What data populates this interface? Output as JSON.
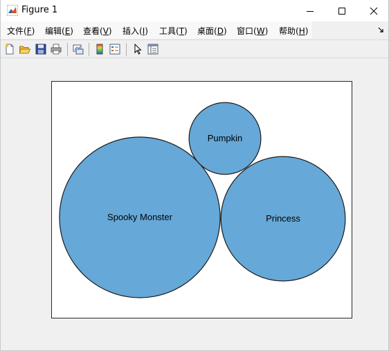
{
  "window": {
    "title": "Figure 1",
    "icons": {
      "app": "matlab-icon",
      "minimize": "minimize-icon",
      "maximize": "maximize-icon",
      "close": "close-icon"
    }
  },
  "menu": {
    "items": [
      {
        "label": "文件(",
        "key": "F",
        "end": ")"
      },
      {
        "label": "编辑(",
        "key": "E",
        "end": ")"
      },
      {
        "label": "查看(",
        "key": "V",
        "end": ")"
      },
      {
        "label": "插入(",
        "key": "I",
        "end": ")"
      },
      {
        "label": "工具(",
        "key": "T",
        "end": ")"
      },
      {
        "label": "桌面(",
        "key": "D",
        "end": ")"
      },
      {
        "label": "窗口(",
        "key": "W",
        "end": ")"
      },
      {
        "label": "帮助(",
        "key": "H",
        "end": ")"
      }
    ],
    "overflow_icon": "expand-arrow-icon"
  },
  "toolbar": {
    "buttons": [
      "new-figure-icon",
      "open-file-icon",
      "save-icon",
      "print-icon",
      "link-plot-icon",
      "colorbar-icon",
      "legend-icon",
      "pointer-icon",
      "property-inspector-icon"
    ]
  },
  "colors": {
    "bubble_fill": "#66a8d7",
    "bubble_edge": "#1a1a1a",
    "axes_bg": "#ffffff"
  },
  "chart_data": {
    "type": "bubble",
    "bubbles": [
      {
        "label": "Spooky Monster",
        "value": 4
      },
      {
        "label": "Princess",
        "value": 2.4
      },
      {
        "label": "Pumpkin",
        "value": 0.8
      }
    ]
  }
}
